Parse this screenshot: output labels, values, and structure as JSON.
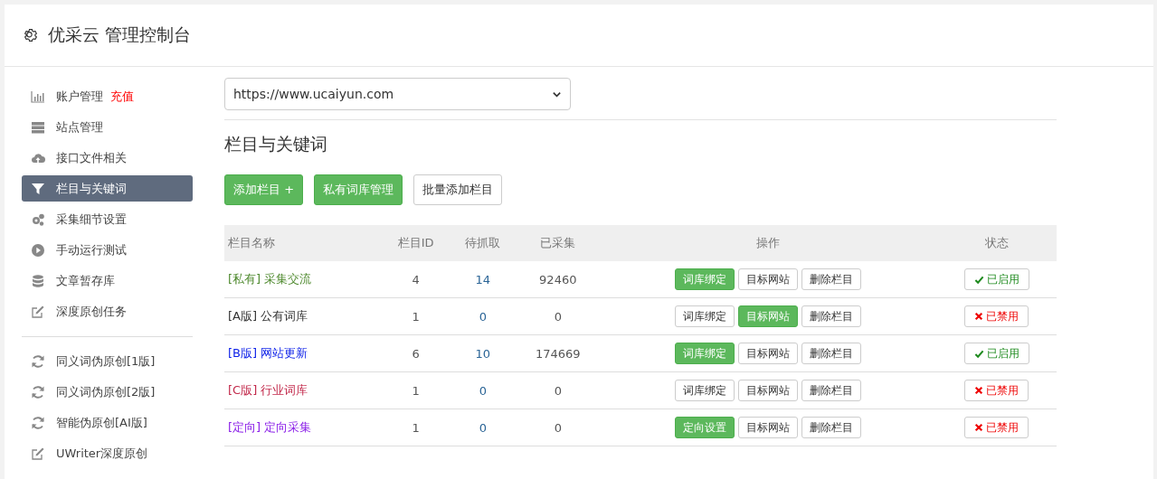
{
  "header": {
    "title": "优采云 管理控制台"
  },
  "sidebar": {
    "groups": [
      {
        "items": [
          {
            "label": "账户管理",
            "badge": "充值",
            "kind": "chart",
            "selected": false
          },
          {
            "label": "站点管理",
            "kind": "server",
            "selected": false
          },
          {
            "label": "接口文件相关",
            "kind": "cloud",
            "selected": false
          },
          {
            "label": "栏目与关键词",
            "kind": "filter",
            "selected": true
          },
          {
            "label": "采集细节设置",
            "kind": "gears",
            "selected": false
          },
          {
            "label": "手动运行测试",
            "kind": "play",
            "selected": false
          },
          {
            "label": "文章暂存库",
            "kind": "database",
            "selected": false
          },
          {
            "label": "深度原创任务",
            "kind": "edit",
            "selected": false
          }
        ]
      },
      {
        "items": [
          {
            "label": "同义词伪原创[1版]",
            "kind": "refresh",
            "selected": false
          },
          {
            "label": "同义词伪原创[2版]",
            "kind": "refresh",
            "selected": false
          },
          {
            "label": "智能伪原创[AI版]",
            "kind": "refresh",
            "selected": false
          },
          {
            "label": "UWriter深度原创",
            "kind": "edit",
            "selected": false
          }
        ]
      }
    ]
  },
  "site_select": {
    "value": "https://www.ucaiyun.com"
  },
  "section_title": "栏目与关键词",
  "toolbar": [
    {
      "label": "添加栏目 +",
      "kind": "green"
    },
    {
      "label": "私有词库管理",
      "kind": "green"
    },
    {
      "label": "批量添加栏目",
      "kind": "plain"
    }
  ],
  "table": {
    "columns": [
      "栏目名称",
      "栏目ID",
      "待抓取",
      "已采集",
      "操作",
      "状态"
    ],
    "rows": [
      {
        "tag": "[私有]",
        "name": "采集交流",
        "color": "#4f8a2f",
        "id": "4",
        "pending": "14",
        "collected": "92460",
        "actions": [
          {
            "label": "词库绑定",
            "kind": "green"
          },
          {
            "label": "目标网站",
            "kind": "plain"
          },
          {
            "label": "删除栏目",
            "kind": "plain"
          }
        ],
        "status": {
          "label": "已启用",
          "enabled": true
        }
      },
      {
        "tag": "[A版]",
        "name": "公有词库",
        "color": "#333333",
        "id": "1",
        "pending": "0",
        "collected": "0",
        "actions": [
          {
            "label": "词库绑定",
            "kind": "plain"
          },
          {
            "label": "目标网站",
            "kind": "green"
          },
          {
            "label": "删除栏目",
            "kind": "plain"
          }
        ],
        "status": {
          "label": "已禁用",
          "enabled": false
        }
      },
      {
        "tag": "[B版]",
        "name": "网站更新",
        "color": "#0a1ee8",
        "id": "6",
        "pending": "10",
        "collected": "174669",
        "actions": [
          {
            "label": "词库绑定",
            "kind": "green"
          },
          {
            "label": "目标网站",
            "kind": "plain"
          },
          {
            "label": "删除栏目",
            "kind": "plain"
          }
        ],
        "status": {
          "label": "已启用",
          "enabled": true
        }
      },
      {
        "tag": "[C版]",
        "name": "行业词库",
        "color": "#c2284a",
        "id": "1",
        "pending": "0",
        "collected": "0",
        "actions": [
          {
            "label": "词库绑定",
            "kind": "plain"
          },
          {
            "label": "目标网站",
            "kind": "plain"
          },
          {
            "label": "删除栏目",
            "kind": "plain"
          }
        ],
        "status": {
          "label": "已禁用",
          "enabled": false
        }
      },
      {
        "tag": "[定向]",
        "name": "定向采集",
        "color": "#8a1ee8",
        "id": "1",
        "pending": "0",
        "collected": "0",
        "actions": [
          {
            "label": "定向设置",
            "kind": "green"
          },
          {
            "label": "目标网站",
            "kind": "plain"
          },
          {
            "label": "删除栏目",
            "kind": "plain"
          }
        ],
        "status": {
          "label": "已禁用",
          "enabled": false
        }
      }
    ]
  }
}
